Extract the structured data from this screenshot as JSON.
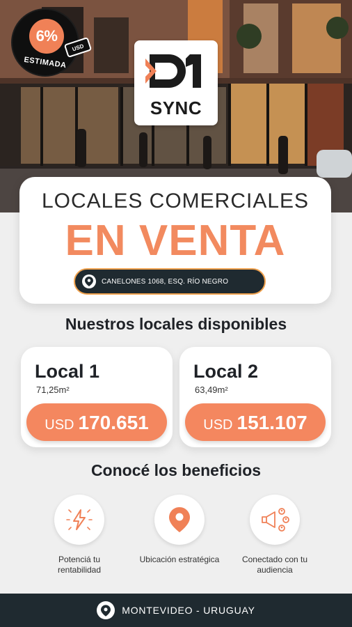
{
  "badge": {
    "percent": "6%",
    "label": "ESTIMADA",
    "tag": "USD"
  },
  "logo": {
    "brand": "SYNC"
  },
  "headline": {
    "top": "LOCALES COMERCIALES",
    "main": "EN VENTA",
    "address": "CANELONES 1068, ESQ. RÍO NEGRO"
  },
  "locales_heading": "Nuestros locales disponibles",
  "locales": [
    {
      "name": "Local 1",
      "area": "71,25m²",
      "currency": "USD",
      "price": "170.651"
    },
    {
      "name": "Local 2",
      "area": "63,49m²",
      "currency": "USD",
      "price": "151.107"
    }
  ],
  "benefits_heading": "Conocé los beneficios",
  "benefits": [
    {
      "label": "Potenciá tu rentabilidad",
      "icon": "lightning-icon"
    },
    {
      "label": "Ubicación estratégica",
      "icon": "location-pin-icon"
    },
    {
      "label": "Conectado con tu audiencia",
      "icon": "megaphone-icon"
    }
  ],
  "footer": {
    "location": "MONTEVIDEO - URUGUAY"
  },
  "colors": {
    "accent": "#f4875f",
    "dark": "#1f2a30",
    "pill_border": "#f0a24e"
  }
}
